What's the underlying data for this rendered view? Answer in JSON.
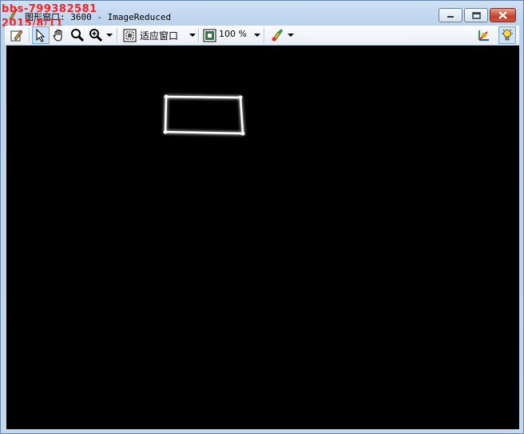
{
  "window": {
    "title_label": "图形窗口",
    "title_rest": ": 3600 - ImageReduced",
    "watermark_line1": "bbs-799382581",
    "watermark_line2": "2015/8/11"
  },
  "toolbar": {
    "zoom_mode": "适应窗口",
    "zoom_percent": "100 %",
    "icons": [
      "edit-icon",
      "pointer-icon",
      "hand-pan-icon",
      "zoom-icon",
      "zoom-in-icon",
      "fit-window-icon",
      "zoom-percent-icon",
      "color-pick-icon",
      "axes-icon",
      "lightbulb-icon"
    ]
  },
  "image": {
    "background": "#000000",
    "object": "white rectangular contour"
  }
}
